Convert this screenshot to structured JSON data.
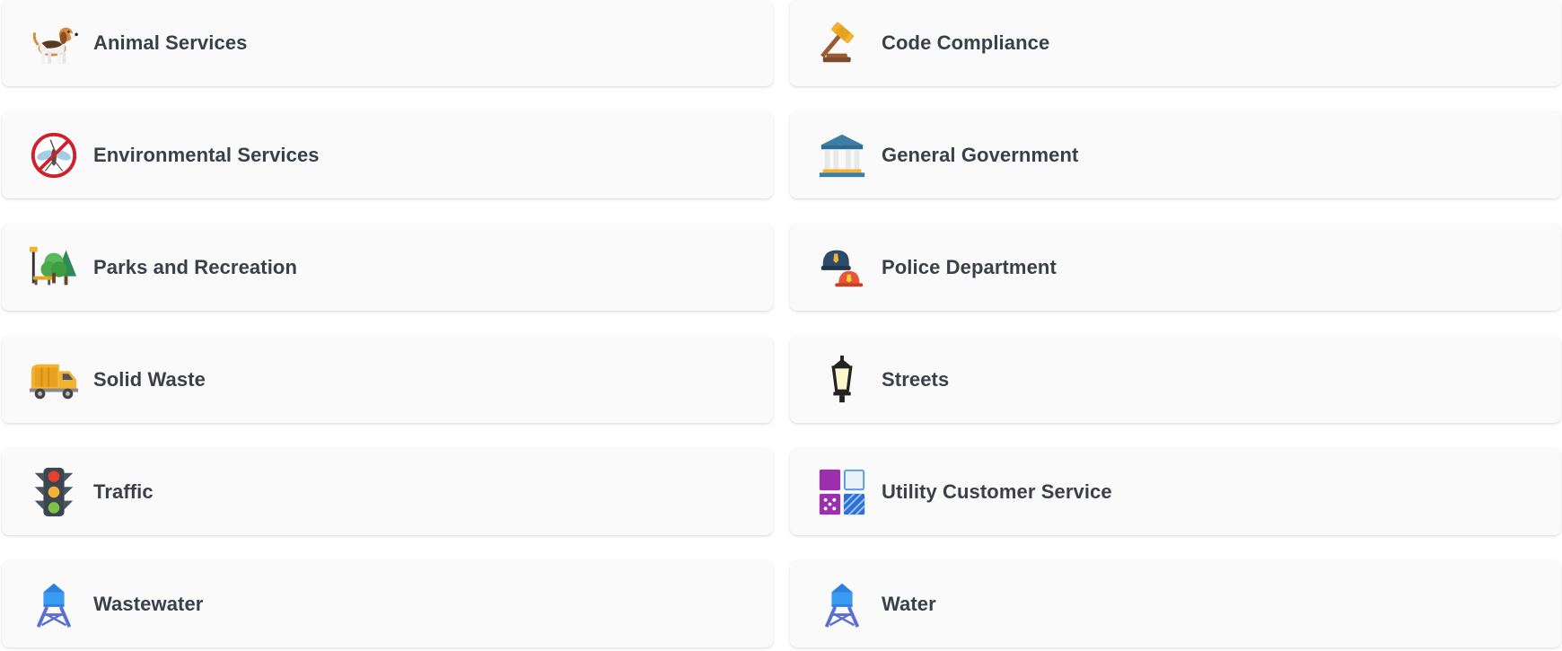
{
  "services": [
    {
      "label": "Animal Services",
      "icon": "dog-icon"
    },
    {
      "label": "Code Compliance",
      "icon": "gavel-icon"
    },
    {
      "label": "Environmental Services",
      "icon": "no-mosquito-icon"
    },
    {
      "label": "General Government",
      "icon": "government-building-icon"
    },
    {
      "label": "Parks and Recreation",
      "icon": "park-icon"
    },
    {
      "label": "Police Department",
      "icon": "police-fire-helmet-icon"
    },
    {
      "label": "Solid Waste",
      "icon": "garbage-truck-icon"
    },
    {
      "label": "Streets",
      "icon": "street-lamp-icon"
    },
    {
      "label": "Traffic",
      "icon": "traffic-light-icon"
    },
    {
      "label": "Utility Customer Service",
      "icon": "utility-tiles-icon"
    },
    {
      "label": "Wastewater",
      "icon": "water-tower-icon"
    },
    {
      "label": "Water",
      "icon": "water-tower-icon"
    }
  ],
  "colors": {
    "card_bg": "#fafafa",
    "label": "#3b3f4a"
  }
}
